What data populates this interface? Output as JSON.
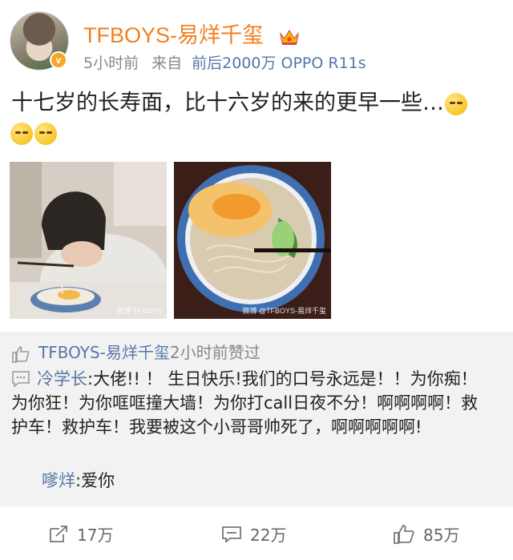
{
  "post": {
    "username": "TFBOYS-易烊千玺",
    "time": "5小时前",
    "from_label": "来自",
    "source": "前后2000万 OPPO R11s",
    "text": "十七岁的长寿面，比十六岁的来的更早一些…",
    "photo_watermark_1": "微博 TFBOYS",
    "photo_watermark_2": "微博 @TFBOYS-易烊千玺"
  },
  "repost": {
    "liker": "TFBOYS-易烊千玺",
    "liked_text": "2小时前赞过",
    "comment_author": "冷学长",
    "comment_text": ":大佬!! ！ 生日快乐!我们的口号永远是！！为你痴！为你狂！为你哐哐撞大墙！为你打call日夜不分！啊啊啊啊！救护车！救护车！我要被这个小哥哥帅死了，啊啊啊啊啊!",
    "reply_author": "嗲烊",
    "reply_text": ":爱你"
  },
  "actions": {
    "repost_count": "17万",
    "comment_count": "22万",
    "like_count": "85万"
  },
  "colors": {
    "username": "#f2801e",
    "link": "#5578a7",
    "repost_bg": "#f2f2f2"
  },
  "icons": [
    "crown-icon",
    "verified-icon",
    "thumbs-up-icon",
    "repost-icon",
    "comment-icon",
    "like-icon"
  ]
}
